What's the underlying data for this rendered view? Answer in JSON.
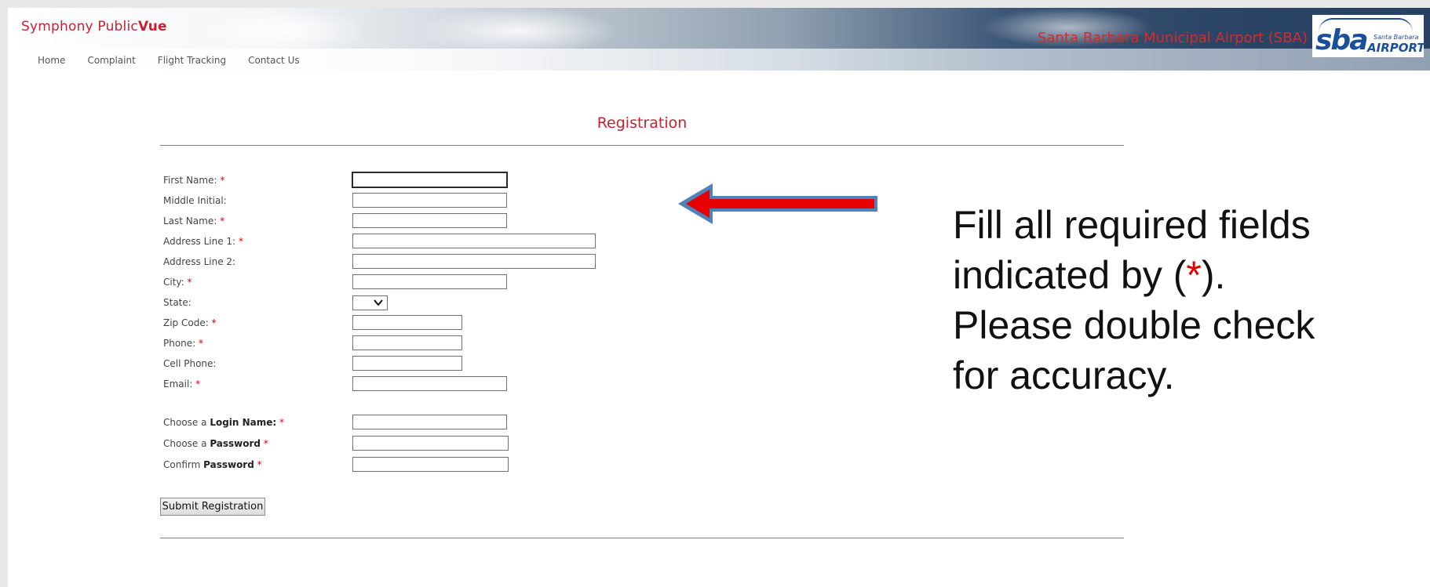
{
  "app": {
    "brand_prefix": "Symphony Public",
    "brand_suffix": "Vue",
    "airport_name": "Santa Barbara Municipal Airport (SBA)",
    "logo": {
      "text": "sba",
      "small_text": "Santa Barbara",
      "airport_text": "AIRPORT"
    }
  },
  "nav": {
    "home": "Home",
    "complaint": "Complaint",
    "flight_tracking": "Flight Tracking",
    "contact_us": "Contact Us"
  },
  "form": {
    "title": "Registration",
    "required_marker": "*",
    "fields": {
      "first_name": {
        "label": "First Name:",
        "value": "",
        "required": true
      },
      "middle_initial": {
        "label": "Middle Initial:",
        "value": "",
        "required": false
      },
      "last_name": {
        "label": "Last Name:",
        "value": "",
        "required": true
      },
      "address1": {
        "label": "Address Line 1:",
        "value": "",
        "required": true
      },
      "address2": {
        "label": "Address Line 2:",
        "value": "",
        "required": false
      },
      "city": {
        "label": "City:",
        "value": "",
        "required": true
      },
      "state": {
        "label": "State:",
        "value": "",
        "required": false
      },
      "zip": {
        "label": "Zip Code:",
        "value": "",
        "required": true
      },
      "phone": {
        "label": "Phone:",
        "value": "",
        "required": true
      },
      "cell_phone": {
        "label": "Cell Phone:",
        "value": "",
        "required": false
      },
      "email": {
        "label": "Email:",
        "value": "",
        "required": true
      }
    },
    "login": {
      "login_name": {
        "prefix": "Choose a",
        "bold": "Login Name:",
        "value": ""
      },
      "password": {
        "prefix": "Choose a",
        "bold": "Password",
        "value": ""
      },
      "confirm_password": {
        "prefix": "Confirm",
        "bold": "Password",
        "value": ""
      }
    },
    "submit_label": "Submit Registration"
  },
  "annotation": {
    "line1": "Fill all required fields",
    "line2_prefix": "indicated by (",
    "line2_star": "*",
    "line2_suffix": ").",
    "line3": "Please double check",
    "line4": "for accuracy.",
    "arrow_color": "#e60000",
    "arrow_outline": "#4f82b9"
  },
  "colors": {
    "brand_red": "#cc1f2f",
    "required_red": "#dd0000"
  }
}
